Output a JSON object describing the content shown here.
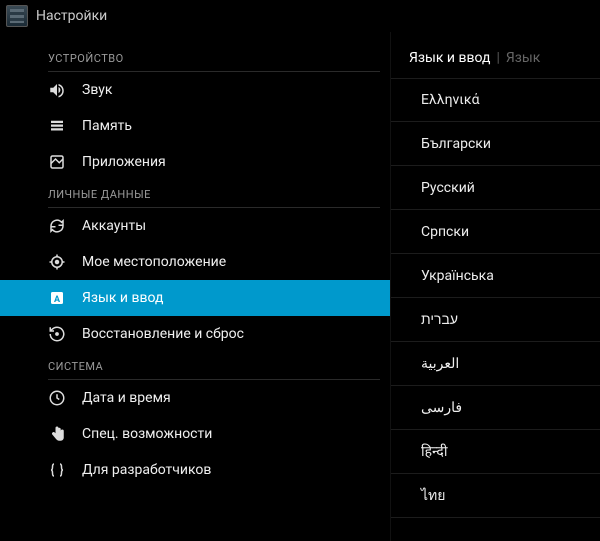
{
  "topbar": {
    "title": "Настройки"
  },
  "left": {
    "sections": [
      {
        "header": "УСТРОЙСТВО",
        "items": [
          {
            "id": "sound",
            "label": "Звук",
            "icon": "volume-icon"
          },
          {
            "id": "storage",
            "label": "Память",
            "icon": "storage-icon"
          },
          {
            "id": "apps",
            "label": "Приложения",
            "icon": "apps-icon"
          }
        ]
      },
      {
        "header": "ЛИЧНЫЕ ДАННЫЕ",
        "items": [
          {
            "id": "accounts",
            "label": "Аккаунты",
            "icon": "sync-icon"
          },
          {
            "id": "location",
            "label": "Мое местоположение",
            "icon": "location-icon"
          },
          {
            "id": "language",
            "label": "Язык и ввод",
            "icon": "language-icon",
            "selected": true
          },
          {
            "id": "backup",
            "label": "Восстановление и сброс",
            "icon": "restore-icon"
          }
        ]
      },
      {
        "header": "СИСТЕМА",
        "items": [
          {
            "id": "datetime",
            "label": "Дата и время",
            "icon": "clock-icon"
          },
          {
            "id": "accessibility",
            "label": "Спец. возможности",
            "icon": "hand-icon"
          },
          {
            "id": "developer",
            "label": "Для разработчиков",
            "icon": "braces-icon"
          }
        ]
      }
    ]
  },
  "right": {
    "title": "Язык и ввод",
    "crumb": "Язык",
    "languages": [
      "Ελληνικά",
      "Български",
      "Русский",
      "Српски",
      "Українська",
      "עברית",
      "العربية",
      "فارسی",
      "हिन्दी",
      "ไทย"
    ]
  }
}
